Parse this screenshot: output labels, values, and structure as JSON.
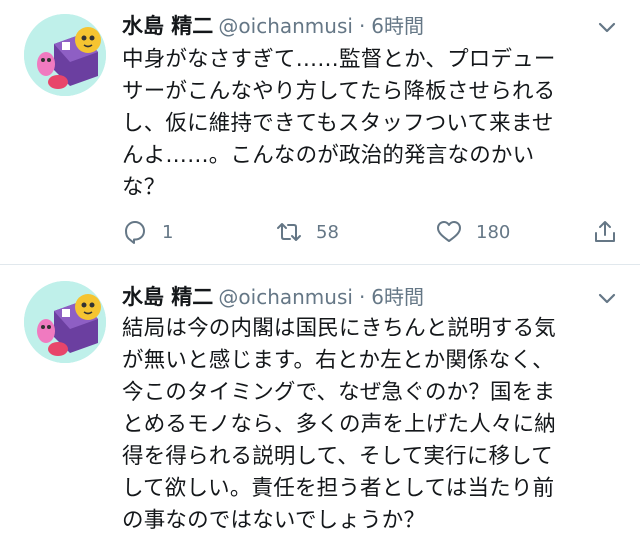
{
  "tweets": [
    {
      "name": "水島 精二",
      "handle": "@oichanmusi",
      "separator": "·",
      "time": "6時間",
      "text": "中身がなさすぎて……監督とか、プロデュー\nサーがこんなやり方してたら降板させられる\nし、仮に維持できてもスタッフついて来ませ\nんよ……。こんなのが政治的発言なのかい\nな？",
      "replies": "1",
      "retweets": "58",
      "likes": "180"
    },
    {
      "name": "水島 精二",
      "handle": "@oichanmusi",
      "separator": "·",
      "time": "6時間",
      "text": "結局は今の内閣は国民にきちんと説明する気\nが無いと感じます。右とか左とか関係なく、\n今このタイミングで、なぜ急ぐのか？国をま\nとめるモノなら、多くの声を上げた人々に納\n得を得られる説明して、そして実行に移して\nして欲しい。責任を担う者としては当たり前\nの事なのではないでしょうか？"
    }
  ],
  "icons": {
    "reply": "reply-icon",
    "retweet": "retweet-icon",
    "like": "heart-icon",
    "share": "share-icon",
    "caret": "chevron-down-icon"
  },
  "colors": {
    "text": "#14171a",
    "secondary": "#657786",
    "divider": "#e1e8ed",
    "avatar_bg": "#bff0ea"
  }
}
